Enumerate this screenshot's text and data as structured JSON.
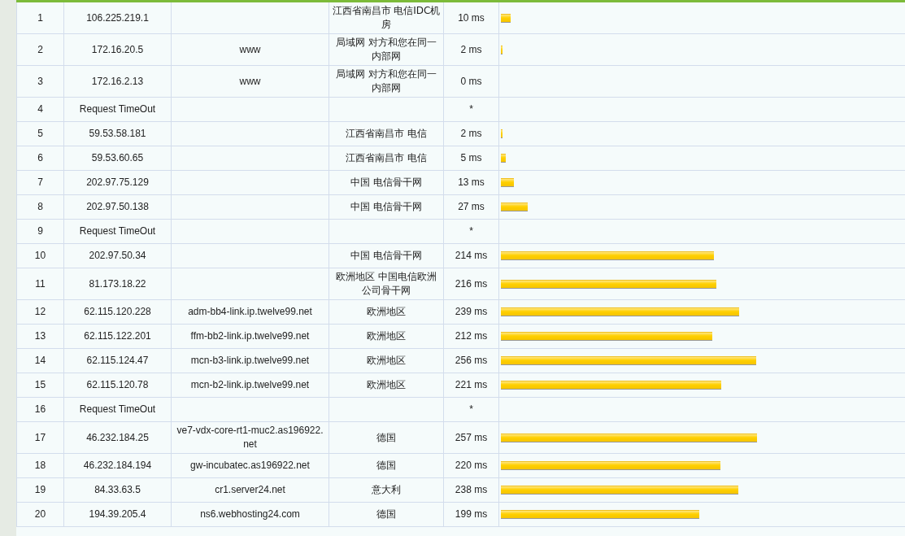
{
  "rows": [
    {
      "hop": "1",
      "ip": "106.225.219.1",
      "location": "江西省南昌市 电信IDC机房",
      "time": "10 ms",
      "level": 0.025
    },
    {
      "hop": "2",
      "ip": "172.16.20.5",
      "hostname": "www",
      "location": "局域网 对方和您在同一内部网",
      "time": "2 ms",
      "level": 0.005
    },
    {
      "hop": "3",
      "ip": "172.16.2.13",
      "hostname": "www",
      "location": "局域网 对方和您在同一内部网",
      "time": "0 ms"
    },
    {
      "hop": "4",
      "ip": "Request TimeOut",
      "time": "*"
    },
    {
      "hop": "5",
      "ip": "59.53.58.181",
      "location": "江西省南昌市 电信",
      "time": "2 ms",
      "level": 0.005
    },
    {
      "hop": "6",
      "ip": "59.53.60.65",
      "location": "江西省南昌市 电信",
      "time": "5 ms",
      "level": 0.012
    },
    {
      "hop": "7",
      "ip": "202.97.75.129",
      "location": "中国 电信骨干网",
      "time": "13 ms",
      "level": 0.032
    },
    {
      "hop": "8",
      "ip": "202.97.50.138",
      "location": "中国 电信骨干网",
      "time": "27 ms",
      "level": 0.067
    },
    {
      "hop": "9",
      "ip": "Request TimeOut",
      "time": "*"
    },
    {
      "hop": "10",
      "ip": "202.97.50.34",
      "location": "中国 电信骨干网",
      "time": "214 ms",
      "level": 0.528
    },
    {
      "hop": "11",
      "ip": "81.173.18.22",
      "location": "欧洲地区 中国电信欧洲公司骨干网",
      "time": "216 ms",
      "level": 0.533
    },
    {
      "hop": "12",
      "ip": "62.115.120.228",
      "hostname": "adm-bb4-link.ip.twelve99.net",
      "location": "欧洲地区",
      "time": "239 ms",
      "level": 0.589
    },
    {
      "hop": "13",
      "ip": "62.115.122.201",
      "hostname": "ffm-bb2-link.ip.twelve99.net",
      "location": "欧洲地区",
      "time": "212 ms",
      "level": 0.523
    },
    {
      "hop": "14",
      "ip": "62.115.124.47",
      "hostname": "mcn-b3-link.ip.twelve99.net",
      "location": "欧洲地区",
      "time": "256 ms",
      "level": 0.631
    },
    {
      "hop": "15",
      "ip": "62.115.120.78",
      "hostname": "mcn-b2-link.ip.twelve99.net",
      "location": "欧洲地区",
      "time": "221 ms",
      "level": 0.545
    },
    {
      "hop": "16",
      "ip": "Request TimeOut",
      "time": "*"
    },
    {
      "hop": "17",
      "ip": "46.232.184.25",
      "hostname": "ve7-vdx-core-rt1-muc2.as196922.net",
      "location": "德国",
      "time": "257 ms",
      "level": 0.634
    },
    {
      "hop": "18",
      "ip": "46.232.184.194",
      "hostname": "gw-incubatec.as196922.net",
      "location": "德国",
      "time": "220 ms",
      "level": 0.543
    },
    {
      "hop": "19",
      "ip": "84.33.63.5",
      "hostname": "cr1.server24.net",
      "location": "意大利",
      "time": "238 ms",
      "level": 0.587
    },
    {
      "hop": "20",
      "ip": "194.39.205.4",
      "hostname": "ns6.webhosting24.com",
      "location": "德国",
      "time": "199 ms",
      "level": 0.491
    }
  ]
}
